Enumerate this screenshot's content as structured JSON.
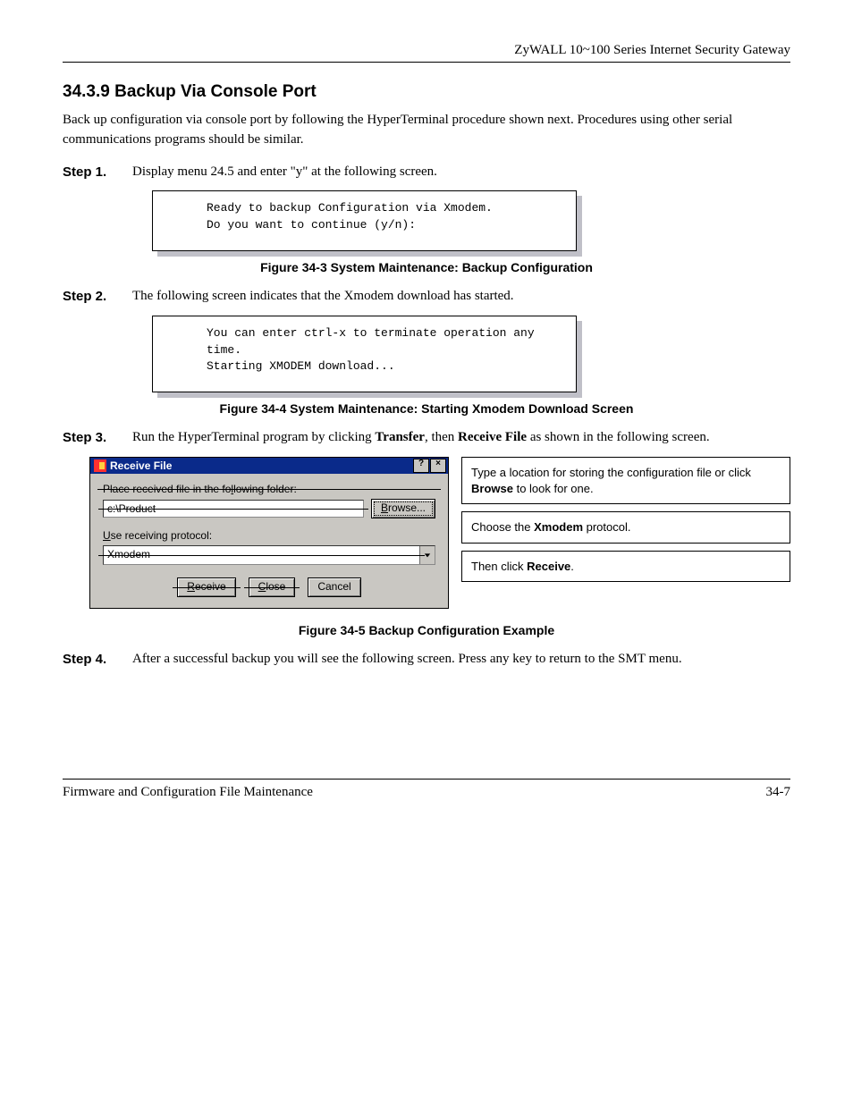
{
  "header": {
    "product": "ZyWALL 10~100 Series Internet Security Gateway"
  },
  "section": {
    "number": "34.3.9",
    "title": "Backup Via Console Port"
  },
  "intro": "Back up configuration via console port by following the HyperTerminal procedure shown next. Procedures using other serial communications programs should be similar.",
  "steps": {
    "s1": {
      "label": "Step 1.",
      "text": "Display menu 24.5 and enter \"y\" at the following screen."
    },
    "s2": {
      "label": "Step 2.",
      "text": "The following screen indicates that the Xmodem download has started."
    },
    "s3": {
      "label": "Step 3.",
      "pre": "Run the HyperTerminal program by clicking ",
      "b1": "Transfer",
      "mid": ", then ",
      "b2": "Receive File",
      "post": " as shown in the following screen."
    },
    "s4": {
      "label": "Step 4.",
      "text": "After a successful backup you will see the following screen. Press any key to return to the SMT menu."
    }
  },
  "term1": "Ready to backup Configuration via Xmodem.\nDo you want to continue (y/n):",
  "term2": "You can enter ctrl-x to terminate operation any\ntime.\nStarting XMODEM download...",
  "figcap1": "Figure 34-3 System Maintenance: Backup Configuration",
  "figcap2": "Figure 34-4 System Maintenance: Starting Xmodem Download Screen",
  "figcap3": "Figure 34-5 Backup Configuration Example",
  "dialog": {
    "title": "Receive File",
    "help_sym": "?",
    "close_sym": "×",
    "folder_label_pre": "Place received file in the fo",
    "folder_label_u": "l",
    "folder_label_post": "lowing folder:",
    "folder_value": "c:\\Product",
    "browse_u": "B",
    "browse_rest": "rowse...",
    "proto_label_u": "U",
    "proto_label_rest": "se receiving protocol:",
    "proto_value": "Xmodem",
    "receive_u": "R",
    "receive_rest": "eceive",
    "close_u": "C",
    "close_rest": "lose",
    "cancel": "Cancel"
  },
  "annot": {
    "a1_pre": "Type a location for storing the configuration file or click ",
    "a1_b": "Browse",
    "a1_post": " to look for one.",
    "a2_pre": "Choose the ",
    "a2_b": "Xmodem",
    "a2_post": " protocol.",
    "a3_pre": "Then click ",
    "a3_b": "Receive",
    "a3_post": "."
  },
  "footer": {
    "left": "Firmware and Configuration File Maintenance",
    "right": "34-7"
  }
}
